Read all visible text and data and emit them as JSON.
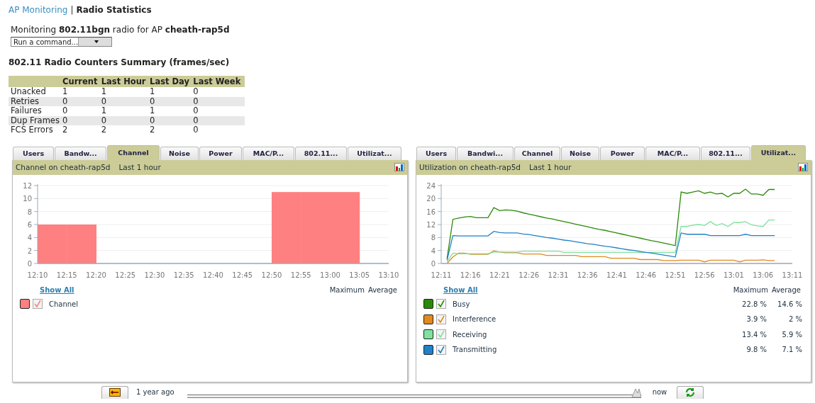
{
  "breadcrumb": {
    "link": "AP Monitoring",
    "separator": "|",
    "current": "Radio Statistics"
  },
  "monitoring_text": "Monitoring **802.11bgn** radio for AP **cheath-rap5d**",
  "command_select": {
    "value": "Run a command..."
  },
  "counters": {
    "title": "802.11 Radio Counters Summary (frames/sec)",
    "columns": [
      "Current",
      "Last Hour",
      "Last Day",
      "Last Week"
    ],
    "rows": [
      {
        "label": "Unacked",
        "values": [
          "1",
          "1",
          "1",
          "0"
        ]
      },
      {
        "label": "Retries",
        "values": [
          "0",
          "0",
          "0",
          "0"
        ]
      },
      {
        "label": "Failures",
        "values": [
          "0",
          "1",
          "1",
          "0"
        ]
      },
      {
        "label": "Dup Frames",
        "values": [
          "0",
          "0",
          "0",
          "0"
        ]
      },
      {
        "label": "FCS Errors",
        "values": [
          "2",
          "2",
          "2",
          "0"
        ]
      }
    ]
  },
  "panels": [
    {
      "tabs": [
        {
          "label": "Users",
          "selected": false
        },
        {
          "label": "Bandw...",
          "selected": false
        },
        {
          "label": "Channel",
          "selected": true
        },
        {
          "label": "Noise",
          "selected": false
        },
        {
          "label": "Power",
          "selected": false
        },
        {
          "label": "MAC/P...",
          "selected": false
        },
        {
          "label": "802.11...",
          "selected": false
        },
        {
          "label": "Utilizat...",
          "selected": false
        }
      ],
      "title": "Channel on cheath-rap5d",
      "period": "Last 1 hour",
      "chart_data": {
        "type": "bar",
        "categories": [
          "12:10",
          "12:15",
          "12:20",
          "12:25",
          "12:30",
          "12:35",
          "12:40",
          "12:45",
          "12:50",
          "12:55",
          "13:00",
          "13:05",
          "13:10"
        ],
        "series": [
          {
            "name": "Channel",
            "color": "#ff8080",
            "values": [
              6,
              6,
              null,
              null,
              null,
              null,
              null,
              null,
              11,
              11,
              11,
              null,
              null
            ]
          }
        ],
        "ylim": [
          0,
          12
        ],
        "yticks": [
          0,
          2,
          4,
          6,
          8,
          10,
          12
        ],
        "grid": true
      },
      "show_all": "Show All",
      "max_header": "Maximum",
      "avg_header": "Average",
      "legend": [
        {
          "checked": true
        }
      ]
    },
    {
      "tabs": [
        {
          "label": "Users",
          "selected": false
        },
        {
          "label": "Bandwi...",
          "selected": false
        },
        {
          "label": "Channel",
          "selected": false
        },
        {
          "label": "Noise",
          "selected": false
        },
        {
          "label": "Power",
          "selected": false
        },
        {
          "label": "MAC/P...",
          "selected": false
        },
        {
          "label": "802.11...",
          "selected": false
        },
        {
          "label": "Utilizat...",
          "selected": true
        }
      ],
      "title": "Utilization on cheath-rap5d",
      "period": "Last 1 hour",
      "chart_data": {
        "type": "line",
        "categories": [
          "12:11",
          null,
          null,
          null,
          null,
          "12:16",
          null,
          null,
          null,
          null,
          "12:21",
          null,
          null,
          null,
          null,
          "12:26",
          null,
          null,
          null,
          null,
          "12:31",
          null,
          null,
          null,
          null,
          "12:36",
          null,
          null,
          null,
          null,
          "12:41",
          null,
          null,
          null,
          null,
          "12:46",
          null,
          null,
          null,
          null,
          "12:51",
          null,
          null,
          null,
          null,
          "12:56",
          null,
          null,
          null,
          null,
          "13:01",
          null,
          null,
          null,
          null,
          "13:06",
          null,
          null,
          null,
          null,
          "13:11"
        ],
        "series": [
          {
            "name": "Busy",
            "color": "#2a8a0a",
            "values": [
              null,
              1.5,
              13.6,
              14.0,
              14.3,
              14.5,
              14.1,
              14.1,
              14.1,
              17.2,
              16.3,
              16.5,
              16.4,
              16.1,
              15.6,
              15.2,
              14.8,
              14.4,
              14.0,
              13.7,
              13.3,
              12.9,
              12.5,
              12.1,
              11.7,
              11.3,
              10.9,
              10.5,
              10.2,
              9.8,
              9.4,
              9.0,
              8.6,
              8.2,
              7.8,
              7.4,
              7.0,
              6.7,
              6.3,
              5.9,
              5.5,
              22.0,
              21.6,
              22.0,
              22.4,
              21.6,
              22.0,
              21.4,
              21.6,
              20.5,
              21.6,
              21.6,
              22.9,
              21.4,
              21.4,
              21.0,
              22.8,
              22.8,
              null,
              null,
              null
            ]
          },
          {
            "name": "Interference",
            "color": "#e08a20",
            "values": [
              null,
              0,
              2.0,
              3.2,
              3.2,
              2.8,
              2.8,
              2.8,
              2.8,
              3.9,
              3.5,
              3.3,
              3.3,
              3.3,
              2.9,
              2.9,
              2.9,
              2.9,
              2.5,
              2.5,
              2.5,
              2.5,
              2.5,
              2.5,
              2.1,
              2.1,
              2.1,
              2.1,
              2.1,
              1.6,
              1.6,
              1.6,
              1.6,
              1.6,
              1.2,
              1.2,
              1.2,
              1.2,
              0.9,
              0.9,
              0.9,
              1.0,
              1.0,
              1.0,
              1.0,
              0.5,
              1.0,
              1.0,
              1.0,
              1.0,
              1.0,
              0.5,
              1.0,
              1.0,
              1.0,
              1.1,
              0.9,
              0.9,
              null,
              null,
              null
            ]
          },
          {
            "name": "Receiving",
            "color": "#80e0a0",
            "values": [
              null,
              0.5,
              3.2,
              3.0,
              3.0,
              3.0,
              3.0,
              3.0,
              3.0,
              3.5,
              3.5,
              3.5,
              3.5,
              3.5,
              3.8,
              3.8,
              3.8,
              3.8,
              3.8,
              3.8,
              3.8,
              3.4,
              3.4,
              3.4,
              3.4,
              3.4,
              3.4,
              3.4,
              3.4,
              3.4,
              3.4,
              3.4,
              3.4,
              3.4,
              3.4,
              3.4,
              3.4,
              3.4,
              3.4,
              3.4,
              3.4,
              11.4,
              11.4,
              11.8,
              12.0,
              11.7,
              12.9,
              11.7,
              12.3,
              11.4,
              12.6,
              12.6,
              12.9,
              11.9,
              11.6,
              11.4,
              13.4,
              13.4,
              null,
              null,
              null
            ]
          },
          {
            "name": "Transmitting",
            "color": "#2080c8",
            "values": [
              null,
              1.0,
              8.6,
              8.5,
              8.5,
              8.5,
              8.5,
              8.5,
              8.5,
              9.9,
              9.5,
              9.4,
              9.4,
              9.4,
              9.1,
              8.9,
              8.6,
              8.3,
              8.0,
              7.8,
              7.5,
              7.2,
              7.0,
              6.7,
              6.4,
              6.1,
              5.9,
              5.6,
              5.3,
              5.1,
              4.8,
              4.5,
              4.2,
              4.0,
              3.7,
              3.4,
              3.2,
              2.9,
              2.6,
              2.3,
              2.0,
              9.4,
              9.0,
              9.0,
              9.0,
              9.0,
              8.6,
              8.6,
              8.6,
              8.6,
              8.6,
              8.6,
              9.0,
              8.6,
              8.6,
              8.6,
              8.6,
              8.6,
              null,
              null,
              null
            ]
          }
        ],
        "ylim": [
          0,
          24
        ],
        "yticks": [
          0,
          4,
          8,
          12,
          16,
          20,
          24
        ],
        "grid": true
      },
      "show_all": "Show All",
      "max_header": "Maximum",
      "avg_header": "Average",
      "legend": [
        {
          "checked": true,
          "maximum": "22.8 %",
          "average": "14.6 %"
        },
        {
          "checked": true,
          "maximum": "3.9 %",
          "average": "2 %"
        },
        {
          "checked": true,
          "maximum": "13.4 %",
          "average": "5.9 %"
        },
        {
          "checked": true,
          "maximum": "9.8 %",
          "average": "7.1 %"
        }
      ]
    }
  ],
  "timeline": {
    "start_label": "1 year ago",
    "end_label": "now",
    "level": 1
  }
}
